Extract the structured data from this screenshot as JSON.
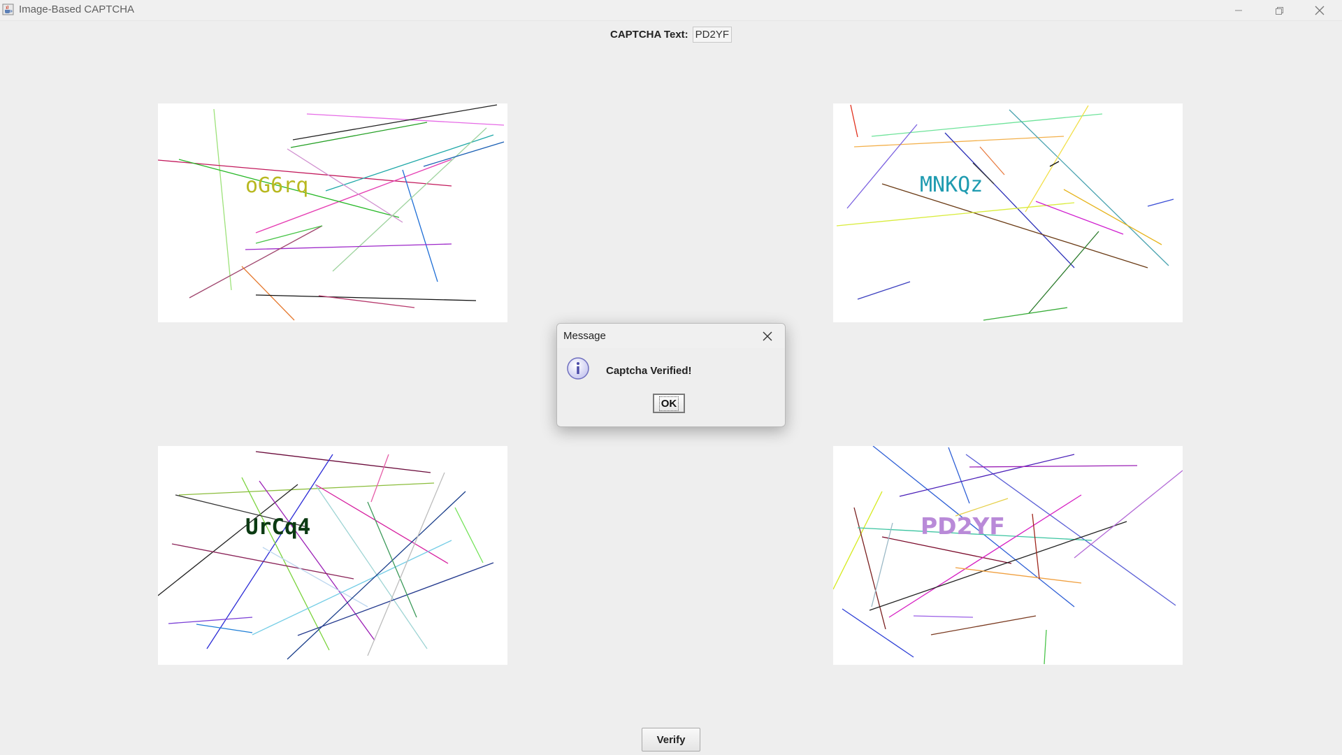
{
  "window": {
    "title": "Image-Based CAPTCHA",
    "icons": {
      "app": "java-cup-icon",
      "minimize": "minimize-icon",
      "maximize": "restore-icon",
      "close": "close-icon"
    }
  },
  "captcha": {
    "label": "CAPTCHA Text:",
    "value": "PD2YF"
  },
  "tiles": [
    {
      "text": "oG6rq",
      "text_color": "#b8b820"
    },
    {
      "text": "MNKQz",
      "text_color": "#1f9bb0"
    },
    {
      "text": "UrCq4",
      "text_color": "#0b3a12"
    },
    {
      "text": "PD2YF",
      "text_color": "#b98ad8"
    }
  ],
  "dialog": {
    "title": "Message",
    "message": "Captcha Verified!",
    "ok_label": "OK",
    "icon": "info-icon"
  },
  "verify_label": "Verify"
}
